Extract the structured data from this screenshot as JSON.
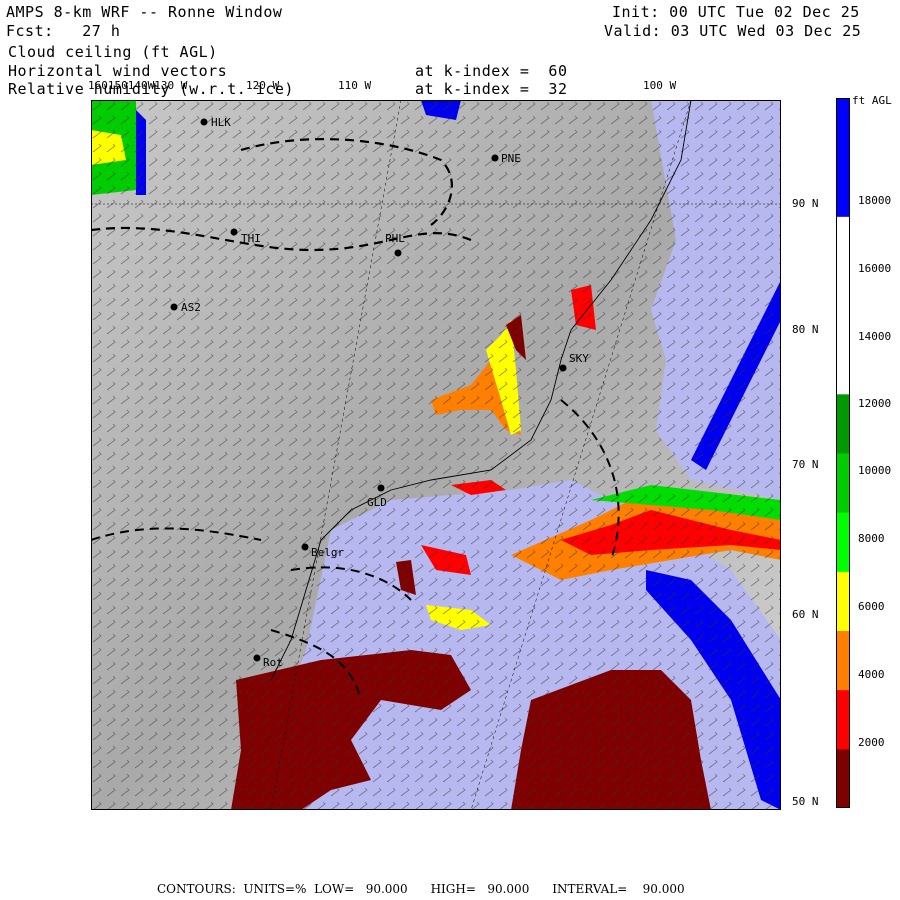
{
  "header": {
    "title": "AMPS 8-km WRF -- Ronne Window",
    "fcst": "Fcst:   27 h",
    "init": "Init: 00 UTC Tue 02 Dec 25",
    "valid": "Valid: 03 UTC Wed 03 Dec 25",
    "field1": "Cloud ceiling (ft AGL)",
    "field2": "Horizontal wind vectors",
    "field3": "Relative humidity (w.r.t. ice)",
    "kindex1": "at k-index =  60",
    "kindex2": "at k-index =  32"
  },
  "lon_labels": [
    "160150140W130 W",
    "120 W",
    "110 W",
    "100 W"
  ],
  "lat_labels": [
    "90 N",
    "80 N",
    "70 N",
    "60 N",
    "50 N"
  ],
  "stations": [
    "HLK",
    "PNE",
    "THI",
    "PHL",
    "AS2",
    "SKY",
    "GLD",
    "Belgr",
    "Rot"
  ],
  "colorbar": {
    "unit": "ft AGL",
    "labels": [
      "18000",
      "16000",
      "14000",
      "12000",
      "10000",
      "8000",
      "6000",
      "4000",
      "2000"
    ],
    "colors": [
      "#7f0000",
      "#ff0000",
      "#ff7f00",
      "#ffff00",
      "#00ff00",
      "#00cc00",
      "#009900",
      "#ffffff",
      "#ffffff",
      "#ffffff",
      "#0000ff",
      "#0000ff"
    ]
  },
  "footer": {
    "text": "CONTOURS:  UNITS=%  LOW=   90.000      HIGH=   90.000      INTERVAL=    90.000"
  }
}
